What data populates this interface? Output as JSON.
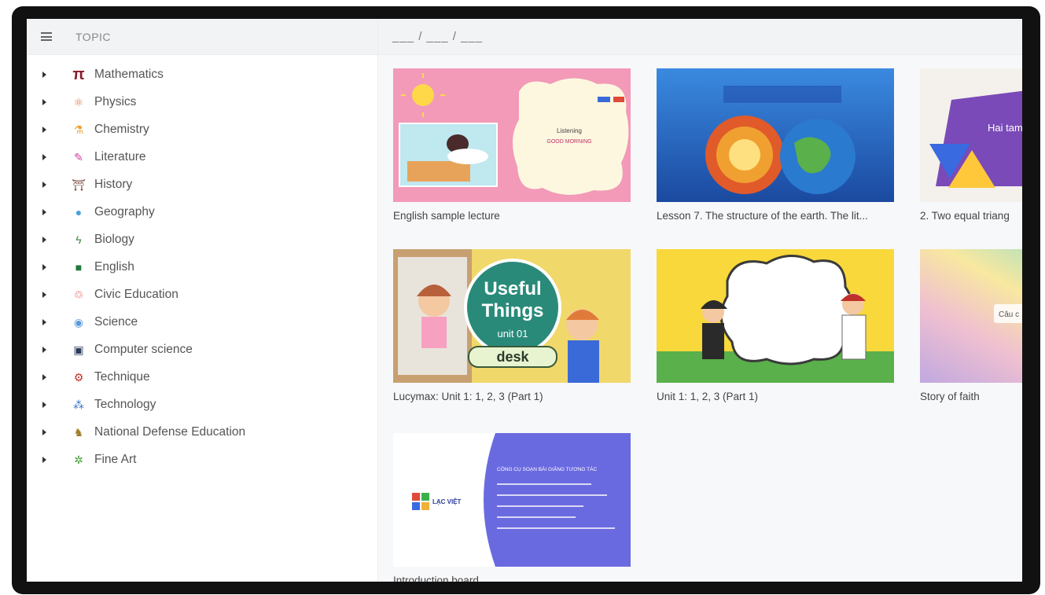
{
  "sidebar": {
    "header": "TOPIC",
    "items": [
      {
        "label": "Mathematics",
        "icon": "pi-icon",
        "glyph": "π",
        "color": "#8a1c2c"
      },
      {
        "label": "Physics",
        "icon": "atom-icon",
        "glyph": "⚛",
        "color": "#e07a3a"
      },
      {
        "label": "Chemistry",
        "icon": "flask-icon",
        "glyph": "⚗",
        "color": "#f0a030"
      },
      {
        "label": "Literature",
        "icon": "pen-icon",
        "glyph": "✎",
        "color": "#d63aa0"
      },
      {
        "label": "History",
        "icon": "temple-icon",
        "glyph": "⛩",
        "color": "#7a4a3a"
      },
      {
        "label": "Geography",
        "icon": "globe-icon",
        "glyph": "●",
        "color": "#4aa0d8"
      },
      {
        "label": "Biology",
        "icon": "microscope-icon",
        "glyph": "ϟ",
        "color": "#3a8a3a"
      },
      {
        "label": "English",
        "icon": "book-icon",
        "glyph": "■",
        "color": "#1f7a3a"
      },
      {
        "label": "Civic Education",
        "icon": "network-icon",
        "glyph": "♲",
        "color": "#d84a4a"
      },
      {
        "label": "Science",
        "icon": "magnifier-icon",
        "glyph": "◉",
        "color": "#5a9ad8"
      },
      {
        "label": "Computer science",
        "icon": "monitor-icon",
        "glyph": "▣",
        "color": "#2a3a5a"
      },
      {
        "label": "Technique",
        "icon": "gear-icon",
        "glyph": "⚙",
        "color": "#c0302a"
      },
      {
        "label": "Technology",
        "icon": "chip-icon",
        "glyph": "⁂",
        "color": "#3a70c8"
      },
      {
        "label": "National Defense Education",
        "icon": "soldier-icon",
        "glyph": "♞",
        "color": "#a07a2a"
      },
      {
        "label": "Fine Art",
        "icon": "palette-icon",
        "glyph": "✲",
        "color": "#4aa03a"
      }
    ]
  },
  "breadcrumb": "___ / ___ / ___",
  "cards": [
    {
      "title": "English sample lecture",
      "thumb_text": [
        "Listening",
        "GOOD MORNING"
      ]
    },
    {
      "title": "Lesson 7. The structure of the earth. The lit...",
      "thumb_text": []
    },
    {
      "title": "2. Two equal triang",
      "thumb_text": [
        "Hai tam g"
      ]
    },
    {
      "title": "Lucymax: Unit 1: 1, 2, 3 (Part 1)",
      "thumb_text": [
        "Useful",
        "Things",
        "unit 01",
        "desk"
      ]
    },
    {
      "title": "Unit 1: 1, 2, 3 (Part 1)",
      "thumb_text": []
    },
    {
      "title": "Story of faith",
      "thumb_text": [
        "Câu c"
      ]
    },
    {
      "title": "Introduction board",
      "thumb_text": [
        "CÔNG CỤ SOẠN BÀI GIẢNG TƯƠNG TÁC",
        "LẠC VIỆT"
      ]
    }
  ]
}
